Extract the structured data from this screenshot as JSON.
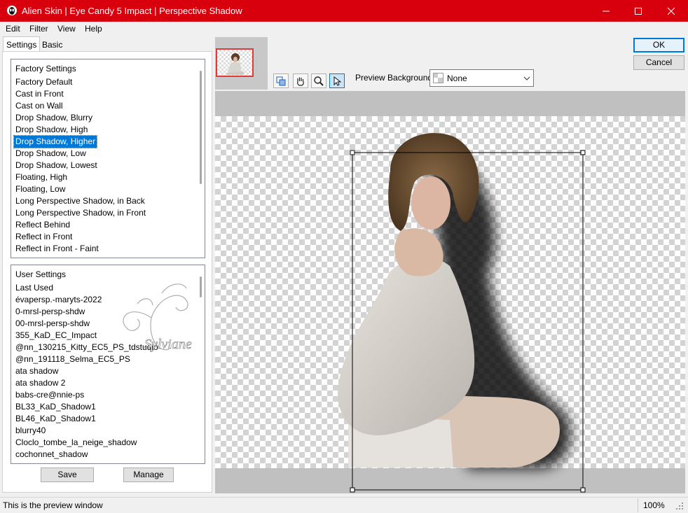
{
  "window": {
    "title": "Alien Skin | Eye Candy 5 Impact | Perspective Shadow"
  },
  "menu": {
    "edit": "Edit",
    "filter": "Filter",
    "view": "View",
    "help": "Help"
  },
  "tabs": {
    "settings": "Settings",
    "basic": "Basic"
  },
  "factory_settings": {
    "header": "Factory Settings",
    "items": [
      "Factory Default",
      "Cast in Front",
      "Cast on Wall",
      "Drop Shadow, Blurry",
      "Drop Shadow, High",
      "Drop Shadow, Higher",
      "Drop Shadow, Low",
      "Drop Shadow, Lowest",
      "Floating, High",
      "Floating, Low",
      "Long Perspective Shadow, in Back",
      "Long Perspective Shadow, in Front",
      "Reflect Behind",
      "Reflect in Front",
      "Reflect in Front - Faint"
    ],
    "selected": "Drop Shadow, Higher"
  },
  "user_settings": {
    "header": "User Settings",
    "items": [
      "Last Used",
      "évapersp.-maryts-2022",
      "0-mrsl-persp-shdw",
      "00-mrsl-persp-shdw",
      "355_KaD_EC_Impact",
      "@nn_130215_Kitty_EC5_PS_tdstudio",
      "@nn_191118_Selma_EC5_PS",
      "ata shadow",
      "ata shadow 2",
      "babs-cre@nnie-ps",
      "BL33_KaD_Shadow1",
      "BL46_KaD_Shadow1",
      "blurry40",
      "Cloclo_tombe_la_neige_shadow",
      "cochonnet_shadow"
    ]
  },
  "buttons": {
    "save": "Save",
    "manage": "Manage",
    "ok": "OK",
    "cancel": "Cancel"
  },
  "toolbar": {
    "preview_background_label": "Preview Background:",
    "preview_background_value": "None"
  },
  "watermark": "Sylviane",
  "status": {
    "message": "This is the preview window",
    "zoom": "100%"
  },
  "colors": {
    "titlebar": "#d8000c",
    "selection": "#0078d7"
  }
}
